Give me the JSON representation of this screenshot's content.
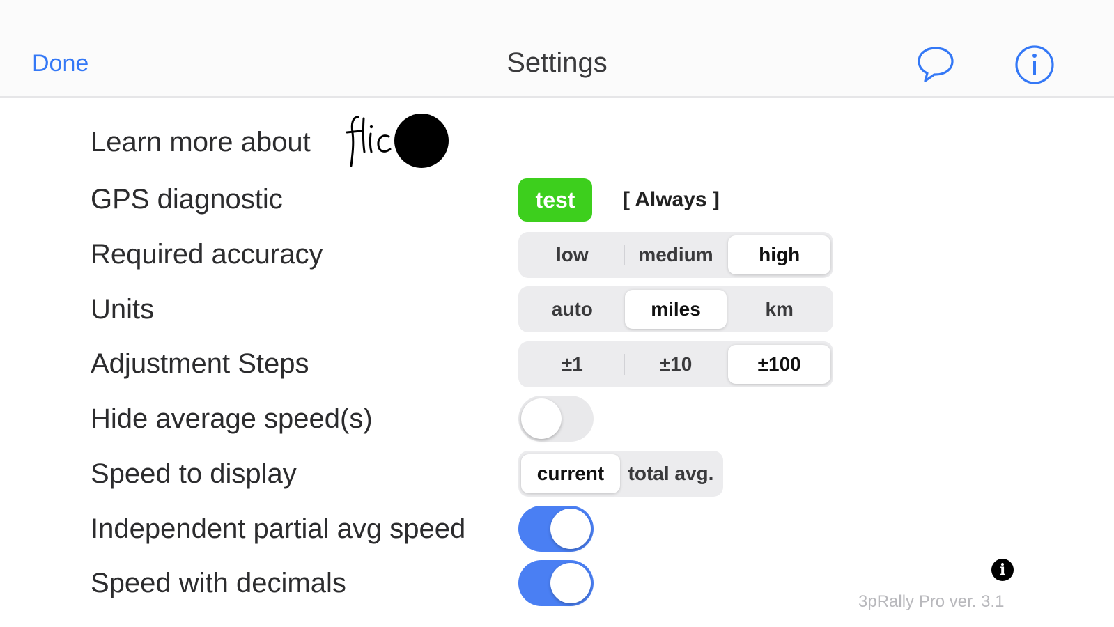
{
  "nav": {
    "done_label": "Done",
    "title": "Settings",
    "chat_icon": "chat-bubble-icon",
    "info_icon": "info-circle-icon",
    "accent_color": "#3478f6"
  },
  "rows": {
    "learn_more": {
      "label": "Learn more about",
      "logo_text": "flic"
    },
    "gps": {
      "label": "GPS diagnostic",
      "test_label": "test",
      "status": "[ Always ]",
      "test_color": "#3dcf1d"
    },
    "accuracy": {
      "label": "Required accuracy",
      "options": [
        "low",
        "medium",
        "high"
      ],
      "selected": "high"
    },
    "units": {
      "label": "Units",
      "options": [
        "auto",
        "miles",
        "km"
      ],
      "selected": "miles"
    },
    "steps": {
      "label": "Adjustment Steps",
      "options": [
        "±1",
        "±10",
        "±100"
      ],
      "selected": "±100"
    },
    "hide_avg": {
      "label": "Hide average speed(s)",
      "value": false
    },
    "speed_display": {
      "label": "Speed to display",
      "options": [
        "current",
        "total avg."
      ],
      "selected": "current"
    },
    "independent_partial": {
      "label": "Independent partial avg speed",
      "value": true
    },
    "decimals": {
      "label": "Speed with decimals",
      "value": true
    }
  },
  "footer": {
    "info_icon": "info-icon",
    "version": "3pRally Pro ver. 3.1"
  },
  "toggle_on_color": "#4a7ff3"
}
